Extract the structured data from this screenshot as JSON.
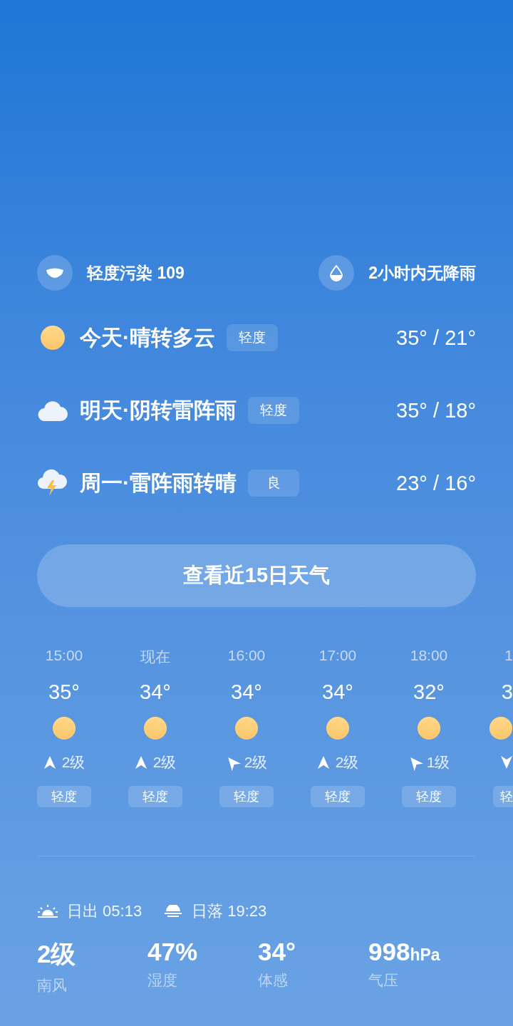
{
  "air_quality": {
    "text": "轻度污染 109"
  },
  "rain": {
    "text": "2小时内无降雨"
  },
  "daily": [
    {
      "kind": "sunny",
      "label": "今天·晴转多云",
      "aqi": "轻度",
      "temps": "35° / 21°"
    },
    {
      "kind": "cloudy",
      "label": "明天·阴转雷阵雨",
      "aqi": "轻度",
      "temps": "35° / 18°"
    },
    {
      "kind": "thunder",
      "label": "周一·雷阵雨转晴",
      "aqi": "良",
      "temps": "23° / 16°"
    }
  ],
  "forecast_button": "查看近15日天气",
  "hourly": [
    {
      "time": "15:00",
      "temp": "35°",
      "kind": "sunny",
      "wind_arrow": {
        "kind": "up"
      },
      "wind": "2级",
      "aqi": "轻度"
    },
    {
      "time": "现在",
      "temp": "34°",
      "kind": "sunny",
      "wind_arrow": {
        "kind": "up"
      },
      "wind": "2级",
      "aqi": "轻度"
    },
    {
      "time": "16:00",
      "temp": "34°",
      "kind": "sunny",
      "wind_arrow": {
        "kind": "upleft"
      },
      "wind": "2级",
      "aqi": "轻度"
    },
    {
      "time": "17:00",
      "temp": "34°",
      "kind": "sunny",
      "wind_arrow": {
        "kind": "up"
      },
      "wind": "2级",
      "aqi": "轻度"
    },
    {
      "time": "18:00",
      "temp": "32°",
      "kind": "sunny",
      "wind_arrow": {
        "kind": "upleft"
      },
      "wind": "1级",
      "aqi": "轻度"
    },
    {
      "time": "1",
      "temp": "3",
      "kind": "sunny",
      "wind_arrow": {
        "kind": "down"
      },
      "aqi": "轻"
    }
  ],
  "sun": {
    "sunrise": "日出 05:13",
    "sunset": "日落 19:23"
  },
  "stats": [
    {
      "value": "2级",
      "label": "南风"
    },
    {
      "value": "47%",
      "label": "湿度"
    },
    {
      "value": "34°",
      "label": "体感"
    },
    {
      "value": "998",
      "unit": "hPa",
      "label": "气压"
    }
  ]
}
